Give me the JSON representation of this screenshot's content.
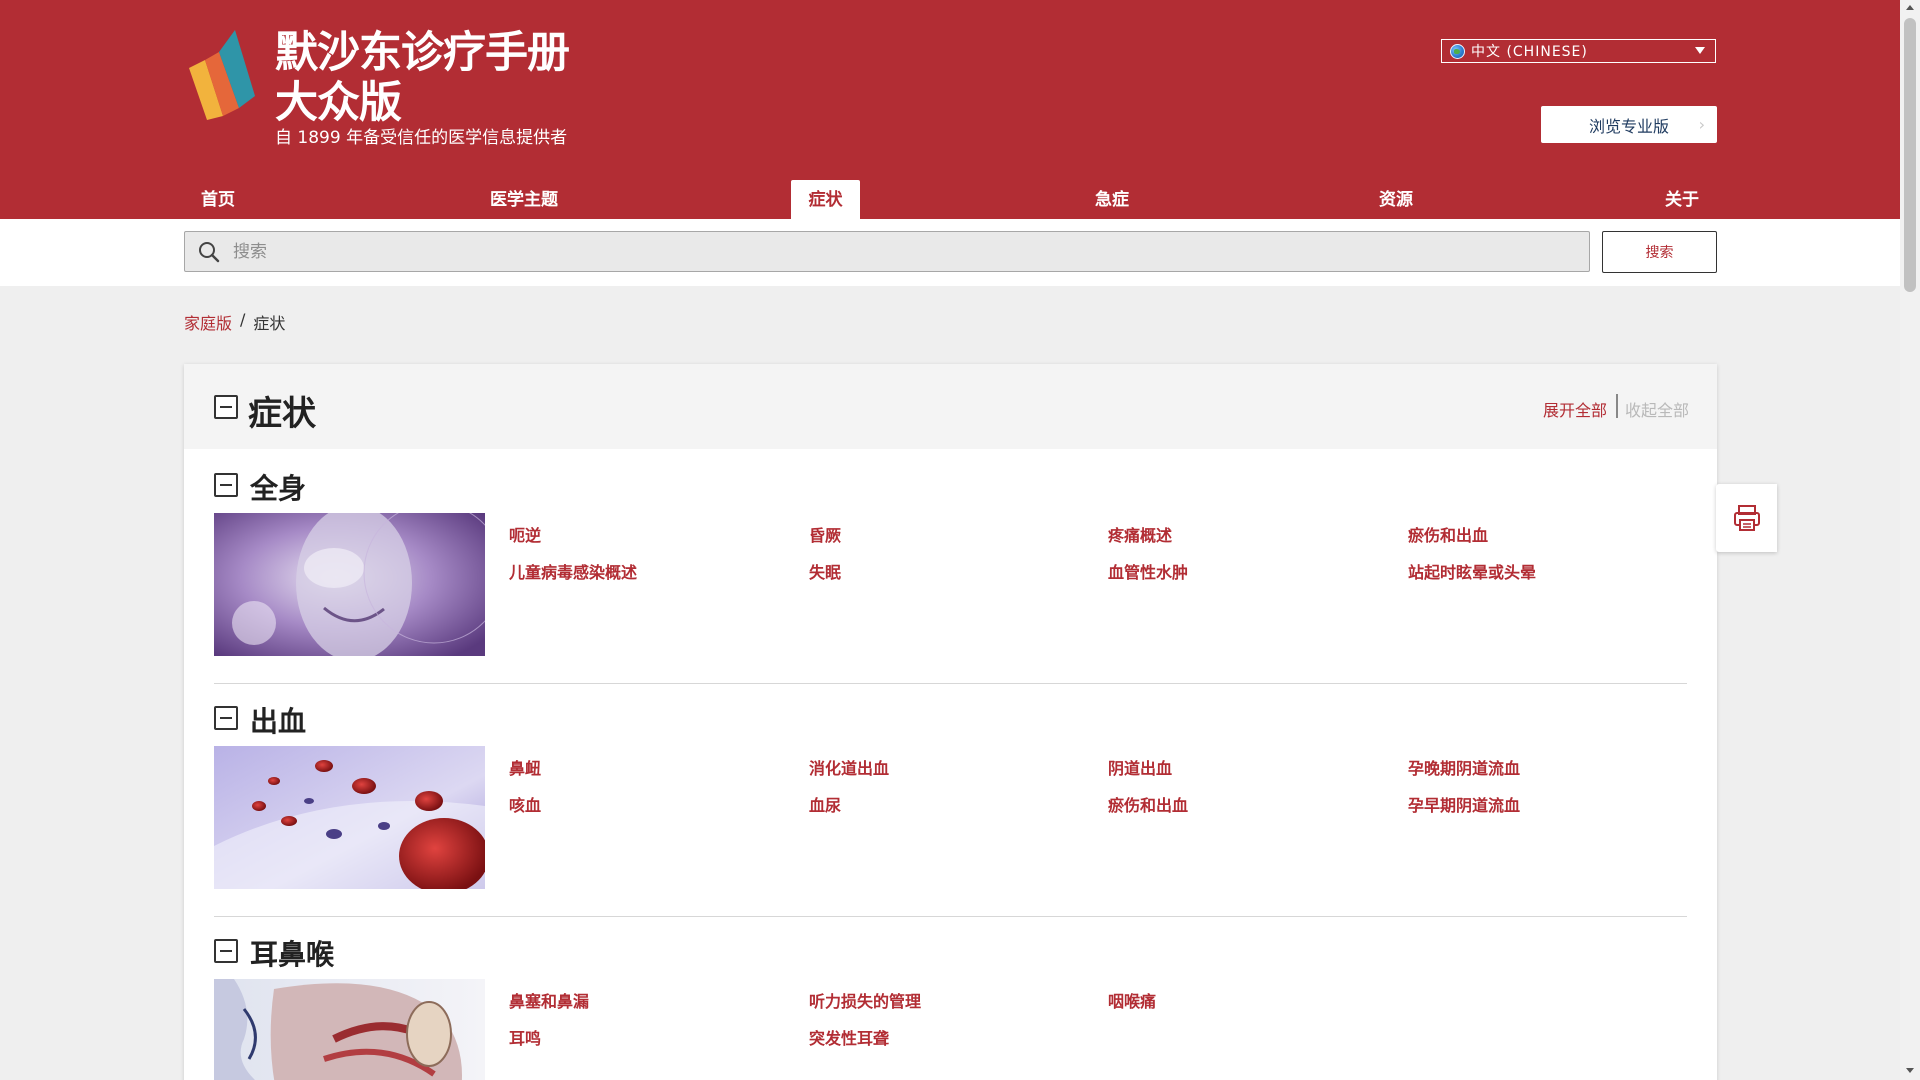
{
  "brand": {
    "title_line1": "默沙东诊疗手册",
    "title_line2": "大众版",
    "tagline": "自 1899 年备受信任的医学信息提供者"
  },
  "header": {
    "language": "中文 (CHINESE)",
    "pro_button": "浏览专业版"
  },
  "nav": {
    "items": [
      {
        "label": "首页"
      },
      {
        "label": "医学主题"
      },
      {
        "label": "症状"
      },
      {
        "label": "急症"
      },
      {
        "label": "资源"
      },
      {
        "label": "关于"
      }
    ],
    "active": "症状"
  },
  "search": {
    "placeholder": "搜索",
    "button": "搜索"
  },
  "breadcrumb": {
    "home": "家庭版",
    "separator": "/",
    "current": "症状"
  },
  "page": {
    "title": "症状",
    "expand_all": "展开全部",
    "collapse_all": "收起全部"
  },
  "sections": [
    {
      "title": "全身",
      "links": [
        [
          "呃逆",
          "昏厥",
          "疼痛概述",
          "瘀伤和出血"
        ],
        [
          "儿童病毒感染概述",
          "失眠",
          "血管性水肿",
          "站起时眩晕或头晕"
        ]
      ]
    },
    {
      "title": "出血",
      "links": [
        [
          "鼻衄",
          "消化道出血",
          "阴道出血",
          "孕晚期阴道流血"
        ],
        [
          "咳血",
          "血尿",
          "瘀伤和出血",
          "孕早期阴道流血"
        ]
      ]
    },
    {
      "title": "耳鼻喉",
      "links": [
        [
          "鼻塞和鼻漏",
          "听力损失的管理",
          "咽喉痛"
        ],
        [
          "耳鸣",
          "突发性耳聋"
        ]
      ]
    }
  ],
  "icons": {
    "logo": "msd-manual-logo",
    "search": "search-icon",
    "print": "print-icon",
    "globe": "globe-icon"
  },
  "colors": {
    "brand_red": "#b22d34",
    "pro_button_text": "#1e3a5f",
    "disabled": "#b9b9b9"
  }
}
